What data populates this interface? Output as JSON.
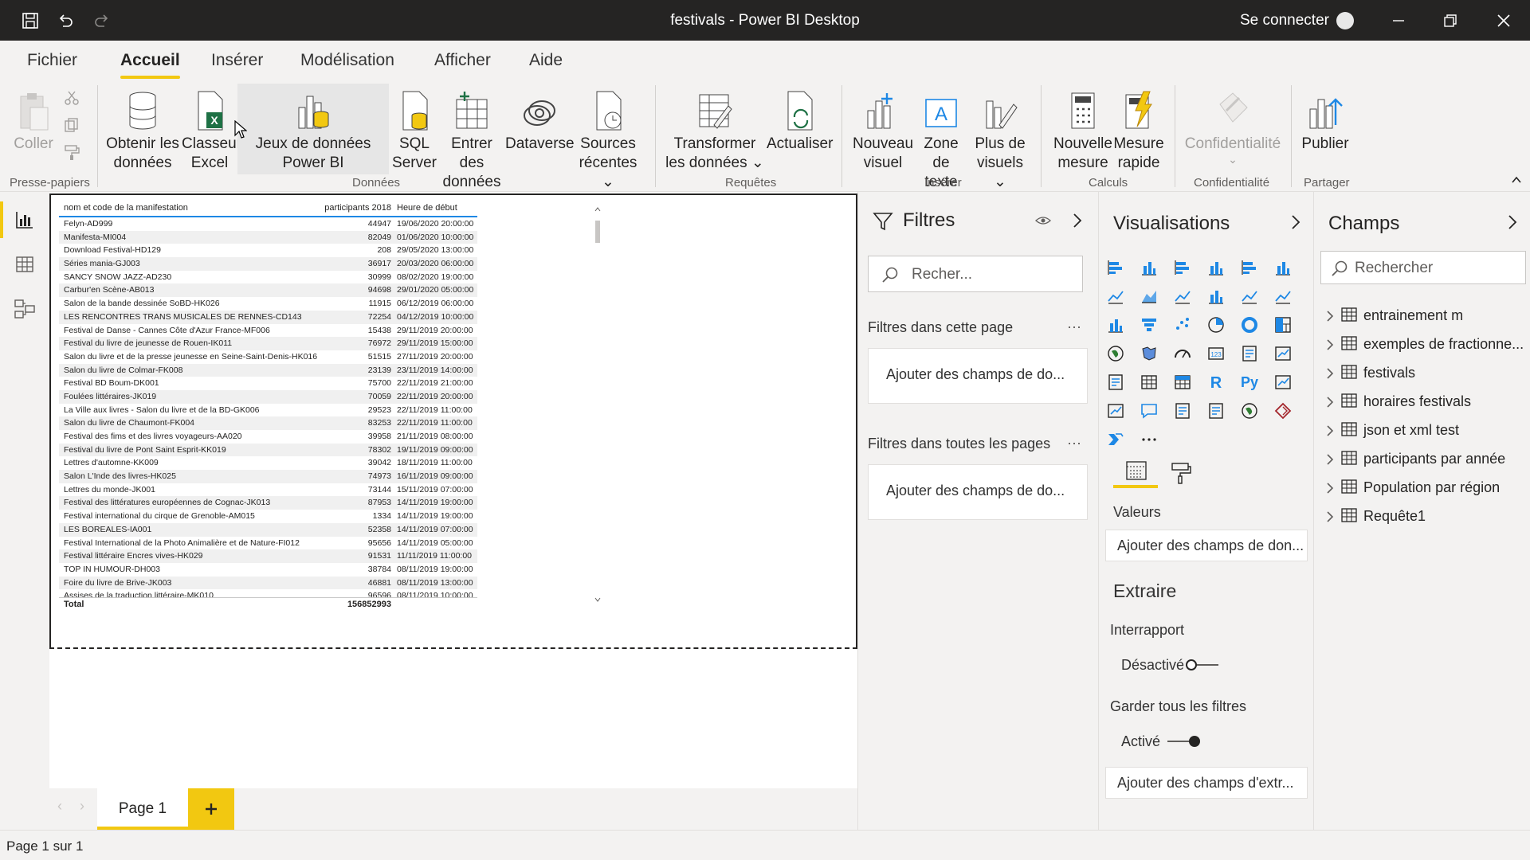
{
  "window": {
    "title": "festivals - Power BI Desktop",
    "signin": "Se connecter"
  },
  "menu": [
    "Fichier",
    "Accueil",
    "Insérer",
    "Modélisation",
    "Afficher",
    "Aide"
  ],
  "ribbon": {
    "paste": "Coller",
    "get_data": "Obtenir les données",
    "excel": "Classeur Excel",
    "pbi_datasets": "Jeux de données Power BI",
    "sql": "SQL Server",
    "enter_data": "Entrer des données",
    "dataverse": "Dataverse",
    "recent": "Sources récentes",
    "transform": "Transformer les données",
    "refresh": "Actualiser",
    "new_visual": "Nouveau visuel",
    "textbox": "Zone de texte",
    "more_visuals": "Plus de visuels",
    "new_measure": "Nouvelle mesure",
    "quick_measure": "Mesure rapide",
    "sensitivity": "Confidentialité",
    "publish": "Publier",
    "groups": {
      "clipboard": "Presse-papiers",
      "data": "Données",
      "queries": "Requêtes",
      "insert": "Insérer",
      "calculations": "Calculs",
      "sensitivity": "Confidentialité",
      "share": "Partager"
    }
  },
  "table": {
    "headers": [
      "nom et code de la manifestation",
      "participants 2018",
      "Heure de début"
    ],
    "rows": [
      [
        "Felyn-AD999",
        "44947",
        "19/06/2020 20:00:00"
      ],
      [
        "Manifesta-MI004",
        "82049",
        "01/06/2020 10:00:00"
      ],
      [
        "Download Festival-HD129",
        "208",
        "29/05/2020 13:00:00"
      ],
      [
        "Séries mania-GJ003",
        "36917",
        "20/03/2020 06:00:00"
      ],
      [
        "SANCY SNOW JAZZ-AD230",
        "30999",
        "08/02/2020 19:00:00"
      ],
      [
        "Carbur'en Scène-AB013",
        "94698",
        "29/01/2020 05:00:00"
      ],
      [
        "Salon de la bande dessinée SoBD-HK026",
        "11915",
        "06/12/2019 06:00:00"
      ],
      [
        "LES RENCONTRES TRANS MUSICALES DE RENNES-CD143",
        "72254",
        "04/12/2019 10:00:00"
      ],
      [
        "Festival de Danse - Cannes Côte d'Azur France-MF006",
        "15438",
        "29/11/2019 20:00:00"
      ],
      [
        "Festival du livre de jeunesse de Rouen-IK011",
        "76972",
        "29/11/2019 15:00:00"
      ],
      [
        "Salon du livre et de la presse jeunesse en Seine-Saint-Denis-HK016",
        "51515",
        "27/11/2019 20:00:00"
      ],
      [
        "Salon du livre de Colmar-FK008",
        "23139",
        "23/11/2019 14:00:00"
      ],
      [
        "Festival BD Boum-DK001",
        "75700",
        "22/11/2019 21:00:00"
      ],
      [
        "Foulées littéraires-JK019",
        "70059",
        "22/11/2019 20:00:00"
      ],
      [
        "La Ville aux livres - Salon du livre et de la BD-GK006",
        "29523",
        "22/11/2019 11:00:00"
      ],
      [
        "Salon du livre de Chaumont-FK004",
        "83253",
        "22/11/2019 11:00:00"
      ],
      [
        "Festival des fims et des livres voyageurs-AA020",
        "39958",
        "21/11/2019 08:00:00"
      ],
      [
        "Festival du livre de Pont Saint Esprit-KK019",
        "78302",
        "19/11/2019 09:00:00"
      ],
      [
        "Lettres d'automne-KK009",
        "39042",
        "18/11/2019 11:00:00"
      ],
      [
        "Salon L'Inde des livres-HK025",
        "74973",
        "16/11/2019 09:00:00"
      ],
      [
        "Lettres du monde-JK001",
        "73144",
        "15/11/2019 07:00:00"
      ],
      [
        "Festival des littératures européennes de Cognac-JK013",
        "87953",
        "14/11/2019 19:00:00"
      ],
      [
        "Festival international du cirque de Grenoble-AM015",
        "1334",
        "14/11/2019 19:00:00"
      ],
      [
        "LES BOREALES-IA001",
        "52358",
        "14/11/2019 07:00:00"
      ],
      [
        "Festival International de la Photo Animalière et de Nature-FI012",
        "95656",
        "14/11/2019 05:00:00"
      ],
      [
        "Festival littéraire Encres vives-HK029",
        "91531",
        "11/11/2019 11:00:00"
      ],
      [
        "TOP IN HUMOUR-DH003",
        "38784",
        "08/11/2019 19:00:00"
      ],
      [
        "Foire du livre de Brive-JK003",
        "46881",
        "08/11/2019 13:00:00"
      ],
      [
        "Assises de la traduction littéraire-MK010",
        "96596",
        "08/11/2019 10:00:00"
      ]
    ],
    "total_label": "Total",
    "total_value": "156852993"
  },
  "pages": {
    "current": "Page 1"
  },
  "filters": {
    "title": "Filtres",
    "search_placeholder": "Recher...",
    "this_page": "Filtres dans cette page",
    "all_pages": "Filtres dans toutes les pages",
    "add_fields": "Ajouter des champs de do..."
  },
  "viz": {
    "title": "Visualisations",
    "values_label": "Valeurs",
    "values_well": "Ajouter des champs de don...",
    "drill_title": "Extraire",
    "cross_report": "Interrapport",
    "cross_state": "Désactivé",
    "keep_filters": "Garder tous les filtres",
    "keep_state": "Activé",
    "drill_well": "Ajouter des champs d'extr..."
  },
  "fields": {
    "title": "Champs",
    "search_placeholder": "Rechercher",
    "tables": [
      "entrainement m",
      "exemples de fractionne...",
      "festivals",
      "horaires festivals",
      "json et xml test",
      "participants par année",
      "Population par région",
      "Requête1"
    ]
  },
  "status": "Page 1 sur 1",
  "colors": {
    "accent": "#f2c811",
    "titlebar": "#252423",
    "table_rule": "#1e88e5"
  }
}
